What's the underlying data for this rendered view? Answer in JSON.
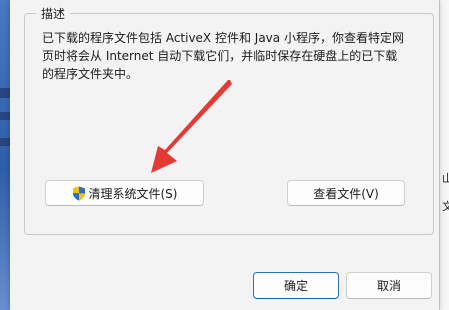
{
  "group": {
    "title": "描述",
    "description_line1": "已下载的程序文件包括 ActiveX 控件和 Java 小程序，你查看特定网",
    "description_line2": "页时将会从 Internet 自动下载它们，并临时保存在硬盘上的已下载",
    "description_line3": "的程序文件夹中。"
  },
  "buttons": {
    "clean_system_files": "清理系统文件(S)",
    "view_files": "查看文件(V)",
    "ok": "确定",
    "cancel": "取消"
  },
  "background_window": {
    "glyph_1": "山",
    "glyph_2": "文"
  },
  "colors": {
    "annotation_arrow": "#e53935",
    "ok_border": "#2e6db4"
  },
  "icons": [
    "uac-shield-icon"
  ]
}
